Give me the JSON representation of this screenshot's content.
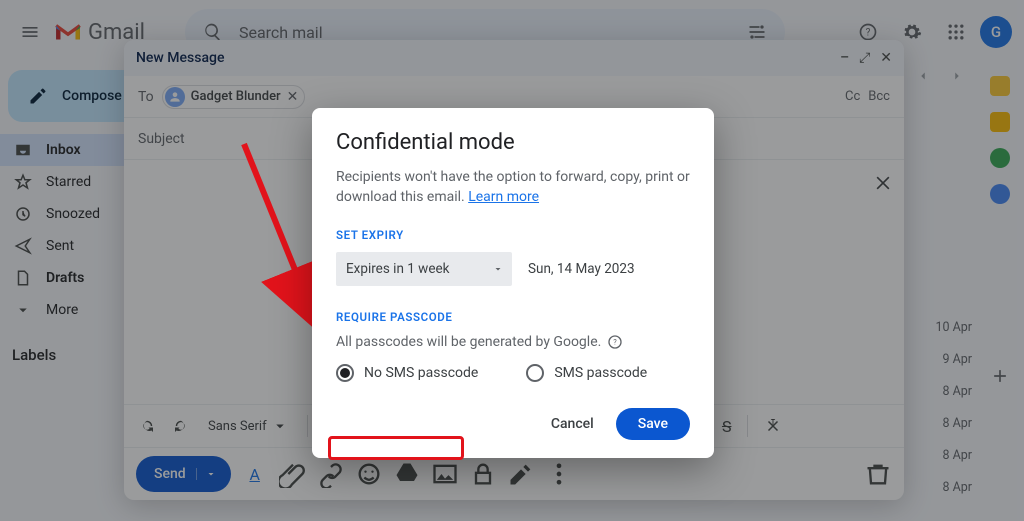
{
  "header": {
    "product": "Gmail",
    "search_placeholder": "Search mail",
    "avatar_initial": "G"
  },
  "sidebar": {
    "compose": "Compose",
    "items": [
      {
        "label": "Inbox"
      },
      {
        "label": "Starred"
      },
      {
        "label": "Snoozed"
      },
      {
        "label": "Sent"
      },
      {
        "label": "Drafts"
      },
      {
        "label": "More"
      }
    ],
    "labels_header": "Labels"
  },
  "compose": {
    "title": "New Message",
    "to_label": "To",
    "chip_name": "Gadget Blunder",
    "cc": "Cc",
    "bcc": "Bcc",
    "subject_placeholder": "Subject",
    "font_label": "Sans Serif",
    "send": "Send"
  },
  "dates": [
    "10 Apr",
    "9 Apr",
    "8 Apr",
    "8 Apr",
    "8 Apr",
    "8 Apr"
  ],
  "dialog": {
    "title": "Confidential mode",
    "desc1": "Recipients won't have the option to forward, copy, print or download this email. ",
    "learn_more": "Learn more",
    "set_expiry": "SET EXPIRY",
    "expiry_value": "Expires in 1 week",
    "expiry_date": "Sun, 14 May 2023",
    "require_passcode": "REQUIRE PASSCODE",
    "passcode_note": "All passcodes will be generated by Google.",
    "radio_no_sms": "No SMS passcode",
    "radio_sms": "SMS passcode",
    "cancel": "Cancel",
    "save": "Save"
  }
}
